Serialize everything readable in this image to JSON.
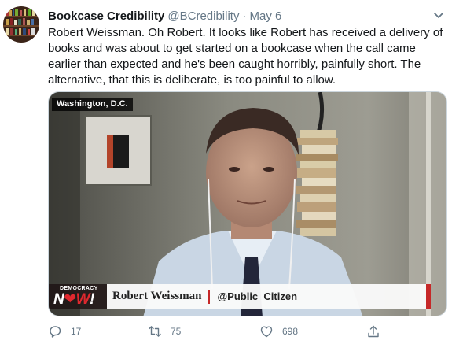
{
  "tweet": {
    "display_name": "Bookcase Credibility",
    "handle": "@BCredibility",
    "separator": "·",
    "date": "May 6",
    "text": "Robert Weissman. Oh Robert. It looks like Robert has received a delivery of books and was about to get started on a bookcase when the call came earlier than expected and he's been caught horribly, painfully short. The alternative, that this is deliberate, is too painful to allow."
  },
  "media": {
    "location_label": "Washington, D.C.",
    "logo_small": "DEMOCRACY",
    "logo_big_left": "N",
    "logo_big_mid": "❤W",
    "logo_big_right": "!",
    "guest_name": "Robert Weissman",
    "guest_org": "@Public_Citizen"
  },
  "actions": {
    "reply_count": "17",
    "retweet_count": "75",
    "like_count": "698"
  },
  "icons": {
    "avatar": "bookcase-avatar",
    "caret": "chevron-down-icon",
    "reply": "reply-icon",
    "retweet": "retweet-icon",
    "like": "heart-icon",
    "share": "share-icon"
  },
  "colors": {
    "text": "#14171a",
    "muted": "#657786",
    "accent_red": "#c62828"
  }
}
